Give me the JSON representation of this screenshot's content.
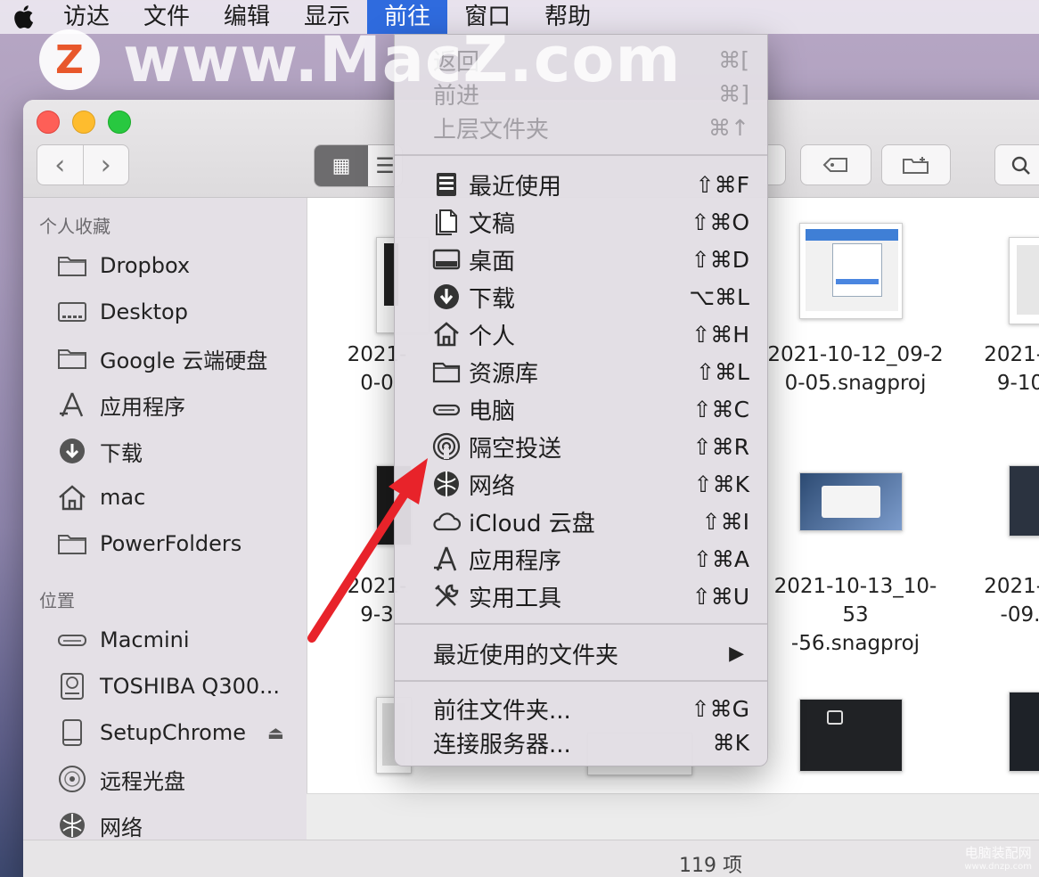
{
  "menubar": {
    "items": [
      {
        "label": "访达",
        "active": false
      },
      {
        "label": "文件",
        "active": false
      },
      {
        "label": "编辑",
        "active": false
      },
      {
        "label": "显示",
        "active": false
      },
      {
        "label": "前往",
        "active": true
      },
      {
        "label": "窗口",
        "active": false
      },
      {
        "label": "帮助",
        "active": false
      }
    ]
  },
  "watermark": {
    "badge": "Z",
    "text": "www.MacZ.com",
    "corner_line1": "电脑装配网",
    "corner_line2": "www.dnzp.com"
  },
  "dropdown": {
    "items": [
      {
        "label": "返回",
        "shortcut": "⌘[",
        "disabled": true,
        "icon": ""
      },
      {
        "label": "前进",
        "shortcut": "⌘]",
        "disabled": true,
        "icon": ""
      },
      {
        "label": "上层文件夹",
        "shortcut": "⌘↑",
        "disabled": true,
        "icon": ""
      },
      {
        "label": "最近使用",
        "shortcut": "⇧⌘F",
        "disabled": false,
        "icon": "recents-icon"
      },
      {
        "label": "文稿",
        "shortcut": "⇧⌘O",
        "disabled": false,
        "icon": "documents-icon"
      },
      {
        "label": "桌面",
        "shortcut": "⇧⌘D",
        "disabled": false,
        "icon": "desktop-icon"
      },
      {
        "label": "下载",
        "shortcut": "⌥⌘L",
        "disabled": false,
        "icon": "downloads-icon"
      },
      {
        "label": "个人",
        "shortcut": "⇧⌘H",
        "disabled": false,
        "icon": "home-icon"
      },
      {
        "label": "资源库",
        "shortcut": "⇧⌘L",
        "disabled": false,
        "icon": "folder-icon"
      },
      {
        "label": "电脑",
        "shortcut": "⇧⌘C",
        "disabled": false,
        "icon": "computer-icon"
      },
      {
        "label": "隔空投送",
        "shortcut": "⇧⌘R",
        "disabled": false,
        "icon": "airdrop-icon"
      },
      {
        "label": "网络",
        "shortcut": "⇧⌘K",
        "disabled": false,
        "icon": "network-icon"
      },
      {
        "label": "iCloud 云盘",
        "shortcut": "⇧⌘I",
        "disabled": false,
        "icon": "icloud-icon"
      },
      {
        "label": "应用程序",
        "shortcut": "⇧⌘A",
        "disabled": false,
        "icon": "applications-icon"
      },
      {
        "label": "实用工具",
        "shortcut": "⇧⌘U",
        "disabled": false,
        "icon": "utilities-icon"
      },
      {
        "label": "最近使用的文件夹",
        "shortcut": "▶",
        "disabled": false,
        "icon": ""
      },
      {
        "label": "前往文件夹...",
        "shortcut": "⇧⌘G",
        "disabled": false,
        "icon": ""
      },
      {
        "label": "连接服务器...",
        "shortcut": "⌘K",
        "disabled": false,
        "icon": ""
      }
    ]
  },
  "sidebar": {
    "favorites_header": "个人收藏",
    "favorites": [
      {
        "label": "Dropbox",
        "icon": "folder-icon"
      },
      {
        "label": "Desktop",
        "icon": "desktop-icon"
      },
      {
        "label": "Google 云端硬盘",
        "icon": "folder-icon"
      },
      {
        "label": "应用程序",
        "icon": "applications-icon"
      },
      {
        "label": "下载",
        "icon": "downloads-icon"
      },
      {
        "label": "mac",
        "icon": "home-icon"
      },
      {
        "label": "PowerFolders",
        "icon": "folder-icon"
      }
    ],
    "locations_header": "位置",
    "locations": [
      {
        "label": "Macmini",
        "icon": "computer-icon"
      },
      {
        "label": "TOSHIBA Q300...",
        "icon": "harddisk-icon"
      },
      {
        "label": "SetupChrome",
        "icon": "disk-image-icon",
        "eject": "⏏"
      },
      {
        "label": "远程光盘",
        "icon": "optical-disc-icon"
      },
      {
        "label": "网络",
        "icon": "network-icon"
      }
    ]
  },
  "files": {
    "row1": [
      {
        "line1": "2021-",
        "line2": "0-0"
      },
      {
        "line1": "2021-10-12_09-2",
        "line2": "0-05.snagproj"
      },
      {
        "line1": "2021-1",
        "line2": "9-10"
      }
    ],
    "row2": [
      {
        "line1": "2021-",
        "line2": "9-3"
      },
      {
        "line1": "2021-10-13_10-53",
        "line2": "-56.snagproj"
      },
      {
        "line1": "2021-1",
        "line2": "-09."
      }
    ]
  },
  "status": {
    "item_count": "119 项"
  },
  "colors": {
    "menu_highlight": "#2f6bde",
    "annotation_arrow": "#e8232a"
  }
}
